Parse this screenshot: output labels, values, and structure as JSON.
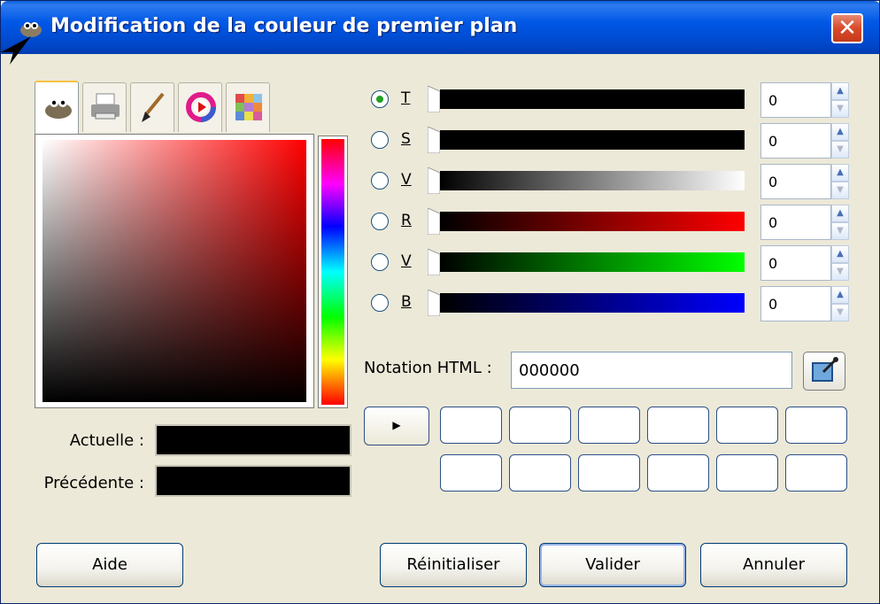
{
  "window": {
    "title": "Modification de la couleur de premier plan"
  },
  "icons": {
    "app": "gimp-wilber-icon",
    "close": "close-icon",
    "tabs": [
      "gimp-selector-icon",
      "printer-cmyk-icon",
      "paintbrush-watercolor-icon",
      "color-wheel-icon",
      "palette-icon"
    ],
    "picker": "eyedropper-icon"
  },
  "close_glyph": "✕",
  "channels": [
    {
      "label": "T",
      "value": "0",
      "checked": true
    },
    {
      "label": "S",
      "value": "0",
      "checked": false
    },
    {
      "label": "V",
      "value": "0",
      "checked": false
    },
    {
      "label": "R",
      "value": "0",
      "checked": false
    },
    {
      "label": "V",
      "value": "0",
      "checked": false
    },
    {
      "label": "B",
      "value": "0",
      "checked": false
    }
  ],
  "html_notation": {
    "label": "Notation HTML :",
    "value": "000000"
  },
  "current": {
    "label": "Actuelle :",
    "color": "#000000"
  },
  "previous": {
    "label": "Précédente :",
    "color": "#000000"
  },
  "history_arrow": "▶",
  "buttons": {
    "help": "Aide",
    "reset": "Réinitialiser",
    "ok": "Valider",
    "cancel": "Annuler"
  },
  "colors": {
    "titlebar": "#0058e6",
    "dialog_bg": "#ece9d8",
    "close": "#d94a2a"
  }
}
